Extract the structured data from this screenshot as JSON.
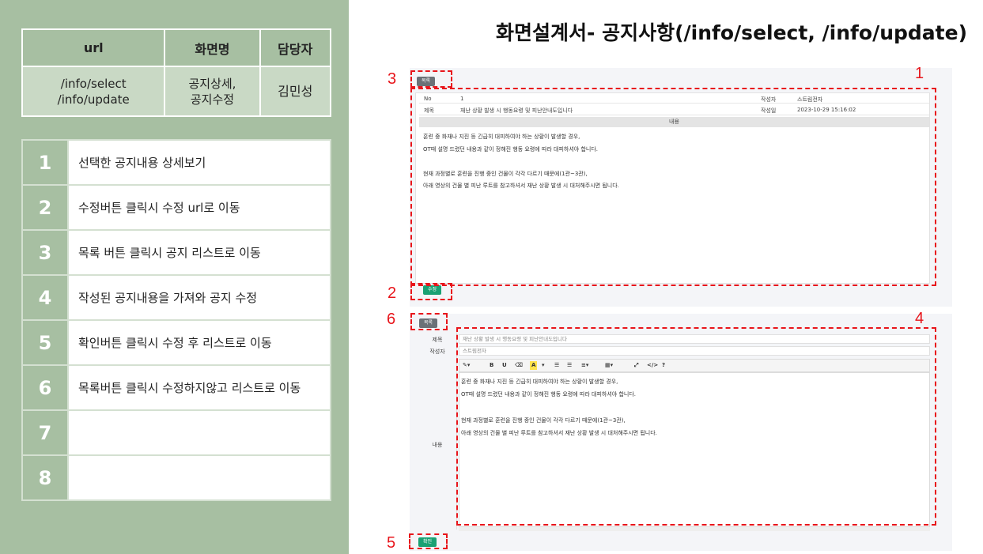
{
  "title": "화면설계서- 공지사항(/info/select, /info/update)",
  "meta_table": {
    "headers": [
      "url",
      "화면명",
      "담당자"
    ],
    "url": "/info/select\n/info/update",
    "screen_name": "공지상세,\n공지수정",
    "owner": "김민성"
  },
  "steps": [
    {
      "num": "1",
      "text": "선택한 공지내용 상세보기"
    },
    {
      "num": "2",
      "text": "수정버튼 클릭시 수정 url로 이동"
    },
    {
      "num": "3",
      "text": "목록 버튼 클릭시 공지 리스트로 이동"
    },
    {
      "num": "4",
      "text": "작성된 공지내용을 가져와 공지 수정"
    },
    {
      "num": "5",
      "text": "확인버튼 클릭시 수정 후 리스트로 이동"
    },
    {
      "num": "6",
      "text": "목록버튼 클릭시 수정하지않고 리스트로 이동"
    },
    {
      "num": "7",
      "text": ""
    },
    {
      "num": "8",
      "text": ""
    }
  ],
  "detail_screen": {
    "list_button": "목록",
    "edit_button": "수정",
    "no_label": "No",
    "no_value": "1",
    "writer_label": "작성자",
    "writer_value": "스트림전자",
    "subject_label": "제목",
    "subject_value": "재난 상황 발생 시 행동요령 및 피난안내도입니다",
    "date_label": "작성일",
    "date_value": "2023-10-29 15:16:02",
    "content_label": "내용",
    "content_lines": [
      "훈련 중 화재나 지진 등 긴급히 대피하여야 하는 상황이 발생할 경우,",
      "OT때 설명 드렸던 내용과 같이 정해진 행동 요령에 따라 대피하셔야 합니다.",
      "",
      "현재 과정별로 훈련을 진행 중인 건물이 각각 다르기 때문에(1관~3관),",
      "아래 영상의 건물 별 피난 루트를 참고하셔서 재난 상황 발생 시 대처해주시면 됩니다."
    ]
  },
  "edit_screen": {
    "list_button": "목록",
    "confirm_button": "확인",
    "subject_label": "제목",
    "subject_value": "재난 상황 발생 시 행동요령 및 피난안내도입니다",
    "writer_label": "작성자",
    "writer_value": "스트림전자",
    "content_label": "내용",
    "toolbar": [
      "B",
      "U",
      "A",
      "?"
    ],
    "content_lines": [
      "훈련 중 화재나 지진 등 긴급히 대피하여야 하는 상황이 발생할 경우,",
      "OT때 설명 드렸던 내용과 같이 정해진 행동 요령에 따라 대피하셔야 합니다.",
      "",
      "현재 과정별로 훈련을 진행 중인 건물이 각각 다르기 때문에(1관~3관),",
      "아래 영상의 건물 별 피난 루트를 참고하셔서 재난 상황 발생 시 대처해주시면 됩니다."
    ]
  },
  "annotations": [
    "1",
    "2",
    "3",
    "4",
    "5",
    "6"
  ],
  "colors": {
    "panel": "#a7bfa2",
    "annotation": "#e8151b",
    "green_button": "#1aa173",
    "gray_button": "#6b7177"
  }
}
